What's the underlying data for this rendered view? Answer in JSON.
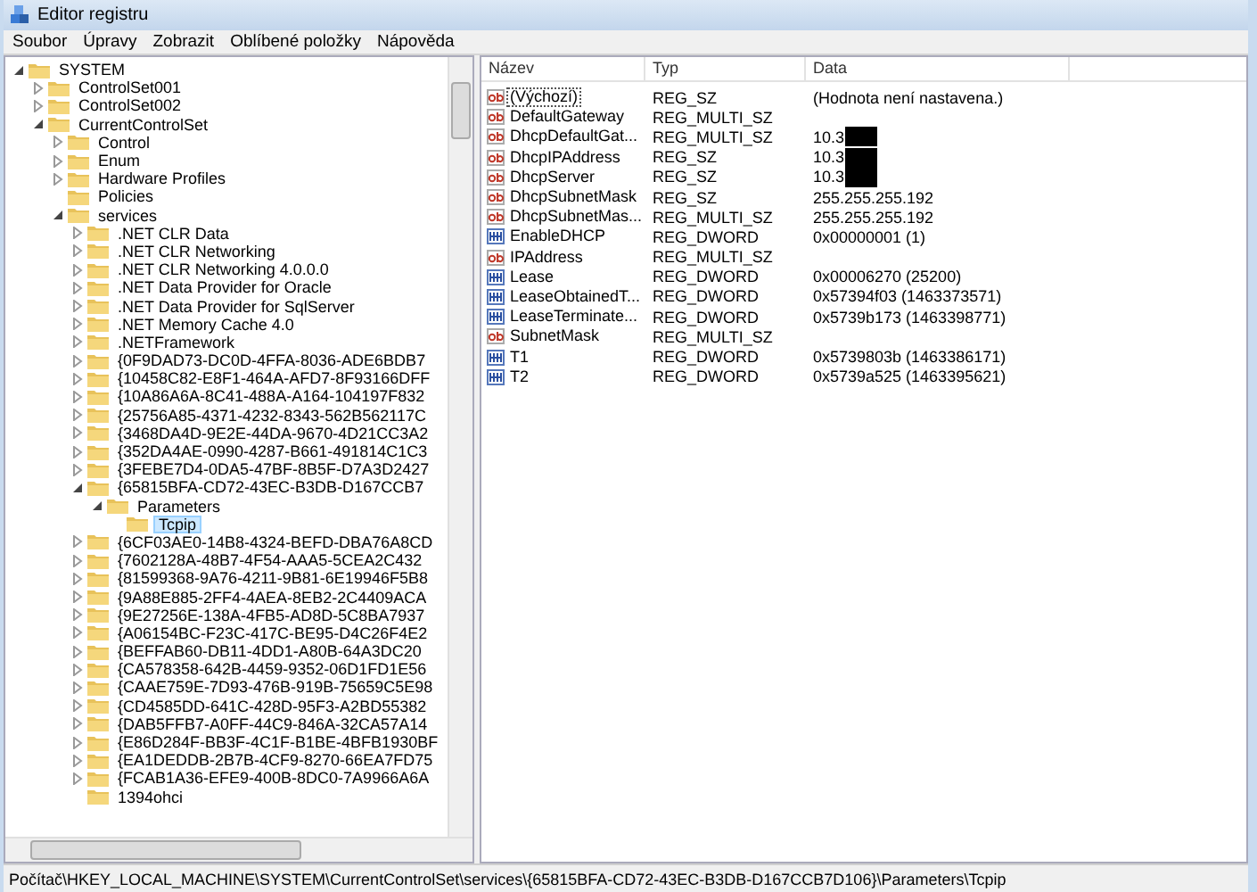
{
  "window": {
    "title": "Editor registru"
  },
  "menu": [
    "Soubor",
    "Úpravy",
    "Zobrazit",
    "Oblíbené položky",
    "Nápověda"
  ],
  "tree": [
    {
      "label": "SYSTEM",
      "expandable": true,
      "expanded": true,
      "selected": false,
      "children": [
        {
          "label": "ControlSet001",
          "expandable": true,
          "expanded": false,
          "selected": false
        },
        {
          "label": "ControlSet002",
          "expandable": true,
          "expanded": false,
          "selected": false
        },
        {
          "label": "CurrentControlSet",
          "expandable": true,
          "expanded": true,
          "selected": false,
          "children": [
            {
              "label": "Control",
              "expandable": true,
              "expanded": false,
              "selected": false
            },
            {
              "label": "Enum",
              "expandable": true,
              "expanded": false,
              "selected": false
            },
            {
              "label": "Hardware Profiles",
              "expandable": true,
              "expanded": false,
              "selected": false
            },
            {
              "label": "Policies",
              "expandable": false,
              "expanded": false,
              "selected": false
            },
            {
              "label": "services",
              "expandable": true,
              "expanded": true,
              "selected": false,
              "children": [
                {
                  "label": ".NET CLR Data",
                  "expandable": true,
                  "expanded": false,
                  "selected": false
                },
                {
                  "label": ".NET CLR Networking",
                  "expandable": true,
                  "expanded": false,
                  "selected": false
                },
                {
                  "label": ".NET CLR Networking 4.0.0.0",
                  "expandable": true,
                  "expanded": false,
                  "selected": false
                },
                {
                  "label": ".NET Data Provider for Oracle",
                  "expandable": true,
                  "expanded": false,
                  "selected": false
                },
                {
                  "label": ".NET Data Provider for SqlServer",
                  "expandable": true,
                  "expanded": false,
                  "selected": false
                },
                {
                  "label": ".NET Memory Cache 4.0",
                  "expandable": true,
                  "expanded": false,
                  "selected": false
                },
                {
                  "label": ".NETFramework",
                  "expandable": true,
                  "expanded": false,
                  "selected": false
                },
                {
                  "label": "{0F9DAD73-DC0D-4FFA-8036-ADE6BDB7",
                  "expandable": true,
                  "expanded": false,
                  "selected": false
                },
                {
                  "label": "{10458C82-E8F1-464A-AFD7-8F93166DFF",
                  "expandable": true,
                  "expanded": false,
                  "selected": false
                },
                {
                  "label": "{10A86A6A-8C41-488A-A164-104197F832",
                  "expandable": true,
                  "expanded": false,
                  "selected": false
                },
                {
                  "label": "{25756A85-4371-4232-8343-562B562117C",
                  "expandable": true,
                  "expanded": false,
                  "selected": false
                },
                {
                  "label": "{3468DA4D-9E2E-44DA-9670-4D21CC3A2",
                  "expandable": true,
                  "expanded": false,
                  "selected": false
                },
                {
                  "label": "{352DA4AE-0990-4287-B661-491814C1C3",
                  "expandable": true,
                  "expanded": false,
                  "selected": false
                },
                {
                  "label": "{3FEBE7D4-0DA5-47BF-8B5F-D7A3D2427",
                  "expandable": true,
                  "expanded": false,
                  "selected": false
                },
                {
                  "label": "{65815BFA-CD72-43EC-B3DB-D167CCB7",
                  "expandable": true,
                  "expanded": true,
                  "selected": false,
                  "children": [
                    {
                      "label": "Parameters",
                      "expandable": true,
                      "expanded": true,
                      "selected": false,
                      "children": [
                        {
                          "label": "Tcpip",
                          "expandable": false,
                          "expanded": false,
                          "selected": true
                        }
                      ]
                    }
                  ]
                },
                {
                  "label": "{6CF03AE0-14B8-4324-BEFD-DBA76A8CD",
                  "expandable": true,
                  "expanded": false,
                  "selected": false
                },
                {
                  "label": "{7602128A-48B7-4F54-AAA5-5CEA2C432",
                  "expandable": true,
                  "expanded": false,
                  "selected": false
                },
                {
                  "label": "{81599368-9A76-4211-9B81-6E19946F5B8",
                  "expandable": true,
                  "expanded": false,
                  "selected": false
                },
                {
                  "label": "{9A88E885-2FF4-4AEA-8EB2-2C4409ACA",
                  "expandable": true,
                  "expanded": false,
                  "selected": false
                },
                {
                  "label": "{9E27256E-138A-4FB5-AD8D-5C8BA7937",
                  "expandable": true,
                  "expanded": false,
                  "selected": false
                },
                {
                  "label": "{A06154BC-F23C-417C-BE95-D4C26F4E2",
                  "expandable": true,
                  "expanded": false,
                  "selected": false
                },
                {
                  "label": "{BEFFAB60-DB11-4DD1-A80B-64A3DC20",
                  "expandable": true,
                  "expanded": false,
                  "selected": false
                },
                {
                  "label": "{CA578358-642B-4459-9352-06D1FD1E56",
                  "expandable": true,
                  "expanded": false,
                  "selected": false
                },
                {
                  "label": "{CAAE759E-7D93-476B-919B-75659C5E98",
                  "expandable": true,
                  "expanded": false,
                  "selected": false
                },
                {
                  "label": "{CD4585DD-641C-428D-95F3-A2BD55382",
                  "expandable": true,
                  "expanded": false,
                  "selected": false
                },
                {
                  "label": "{DAB5FFB7-A0FF-44C9-846A-32CA57A14",
                  "expandable": true,
                  "expanded": false,
                  "selected": false
                },
                {
                  "label": "{E86D284F-BB3F-4C1F-B1BE-4BFB1930BF",
                  "expandable": true,
                  "expanded": false,
                  "selected": false
                },
                {
                  "label": "{EA1DEDDB-2B7B-4CF9-8270-66EA7FD75",
                  "expandable": true,
                  "expanded": false,
                  "selected": false
                },
                {
                  "label": "{FCAB1A36-EFE9-400B-8DC0-7A9966A6A",
                  "expandable": true,
                  "expanded": false,
                  "selected": false
                },
                {
                  "label": "1394ohci",
                  "expandable": false,
                  "expanded": false,
                  "selected": false
                }
              ]
            }
          ]
        }
      ]
    }
  ],
  "columns": [
    "Název",
    "Typ",
    "Data"
  ],
  "values": [
    {
      "kind": "string",
      "name": "(Výchozí)",
      "type": "REG_SZ",
      "data": "(Hodnota není nastavena.)",
      "focused": true,
      "redacted": false
    },
    {
      "kind": "string",
      "name": "DefaultGateway",
      "type": "REG_MULTI_SZ",
      "focused": false,
      "redacted": false
    },
    {
      "kind": "string",
      "name": "DhcpDefaultGat...",
      "type": "REG_MULTI_SZ",
      "data": "10.3",
      "focused": false,
      "redacted": true
    },
    {
      "kind": "string",
      "name": "DhcpIPAddress",
      "type": "REG_SZ",
      "data": "10.3",
      "focused": false,
      "redacted": true
    },
    {
      "kind": "string",
      "name": "DhcpServer",
      "type": "REG_SZ",
      "data": "10.3",
      "focused": false,
      "redacted": true
    },
    {
      "kind": "string",
      "name": "DhcpSubnetMask",
      "type": "REG_SZ",
      "data": "255.255.255.192",
      "focused": false,
      "redacted": false
    },
    {
      "kind": "string",
      "name": "DhcpSubnetMas...",
      "type": "REG_MULTI_SZ",
      "data": "255.255.255.192",
      "focused": false,
      "redacted": false
    },
    {
      "kind": "binary",
      "name": "EnableDHCP",
      "type": "REG_DWORD",
      "data": "0x00000001 (1)",
      "focused": false,
      "redacted": false
    },
    {
      "kind": "string",
      "name": "IPAddress",
      "type": "REG_MULTI_SZ",
      "focused": false,
      "redacted": false
    },
    {
      "kind": "binary",
      "name": "Lease",
      "type": "REG_DWORD",
      "data": "0x00006270 (25200)",
      "focused": false,
      "redacted": false
    },
    {
      "kind": "binary",
      "name": "LeaseObtainedT...",
      "type": "REG_DWORD",
      "data": "0x57394f03 (1463373571)",
      "focused": false,
      "redacted": false
    },
    {
      "kind": "binary",
      "name": "LeaseTerminate...",
      "type": "REG_DWORD",
      "data": "0x5739b173 (1463398771)",
      "focused": false,
      "redacted": false
    },
    {
      "kind": "string",
      "name": "SubnetMask",
      "type": "REG_MULTI_SZ",
      "focused": false,
      "redacted": false
    },
    {
      "kind": "binary",
      "name": "T1",
      "type": "REG_DWORD",
      "data": "0x5739803b (1463386171)",
      "focused": false,
      "redacted": false
    },
    {
      "kind": "binary",
      "name": "T2",
      "type": "REG_DWORD",
      "data": "0x5739a525 (1463395621)",
      "focused": false,
      "redacted": false
    }
  ],
  "status_bar": "Počítač\\HKEY_LOCAL_MACHINE\\SYSTEM\\CurrentControlSet\\services\\{65815BFA-CD72-43EC-B3DB-D167CCB7D106}\\Parameters\\Tcpip"
}
